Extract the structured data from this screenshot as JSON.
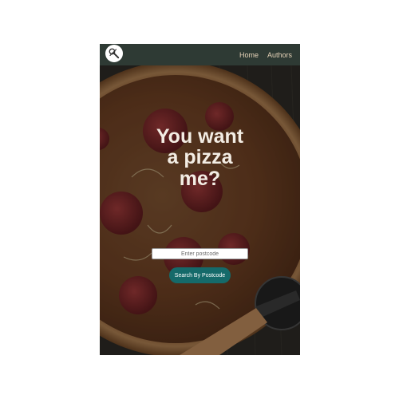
{
  "navbar": {
    "logo_icon": "pizza-cutter-icon",
    "links": [
      {
        "label": "Home"
      },
      {
        "label": "Authors"
      }
    ],
    "background_color": "#2e3a34",
    "link_color": "#e6d3b8"
  },
  "hero": {
    "background_image": "pepperoni-pizza-photo",
    "headline_lines": [
      "You want",
      "a pizza",
      "me?"
    ],
    "headline_color": "#f3ede4"
  },
  "search": {
    "placeholder": "Enter postcode",
    "value": "",
    "button_label": "Search By Postcode",
    "button_color": "#156a6a"
  }
}
